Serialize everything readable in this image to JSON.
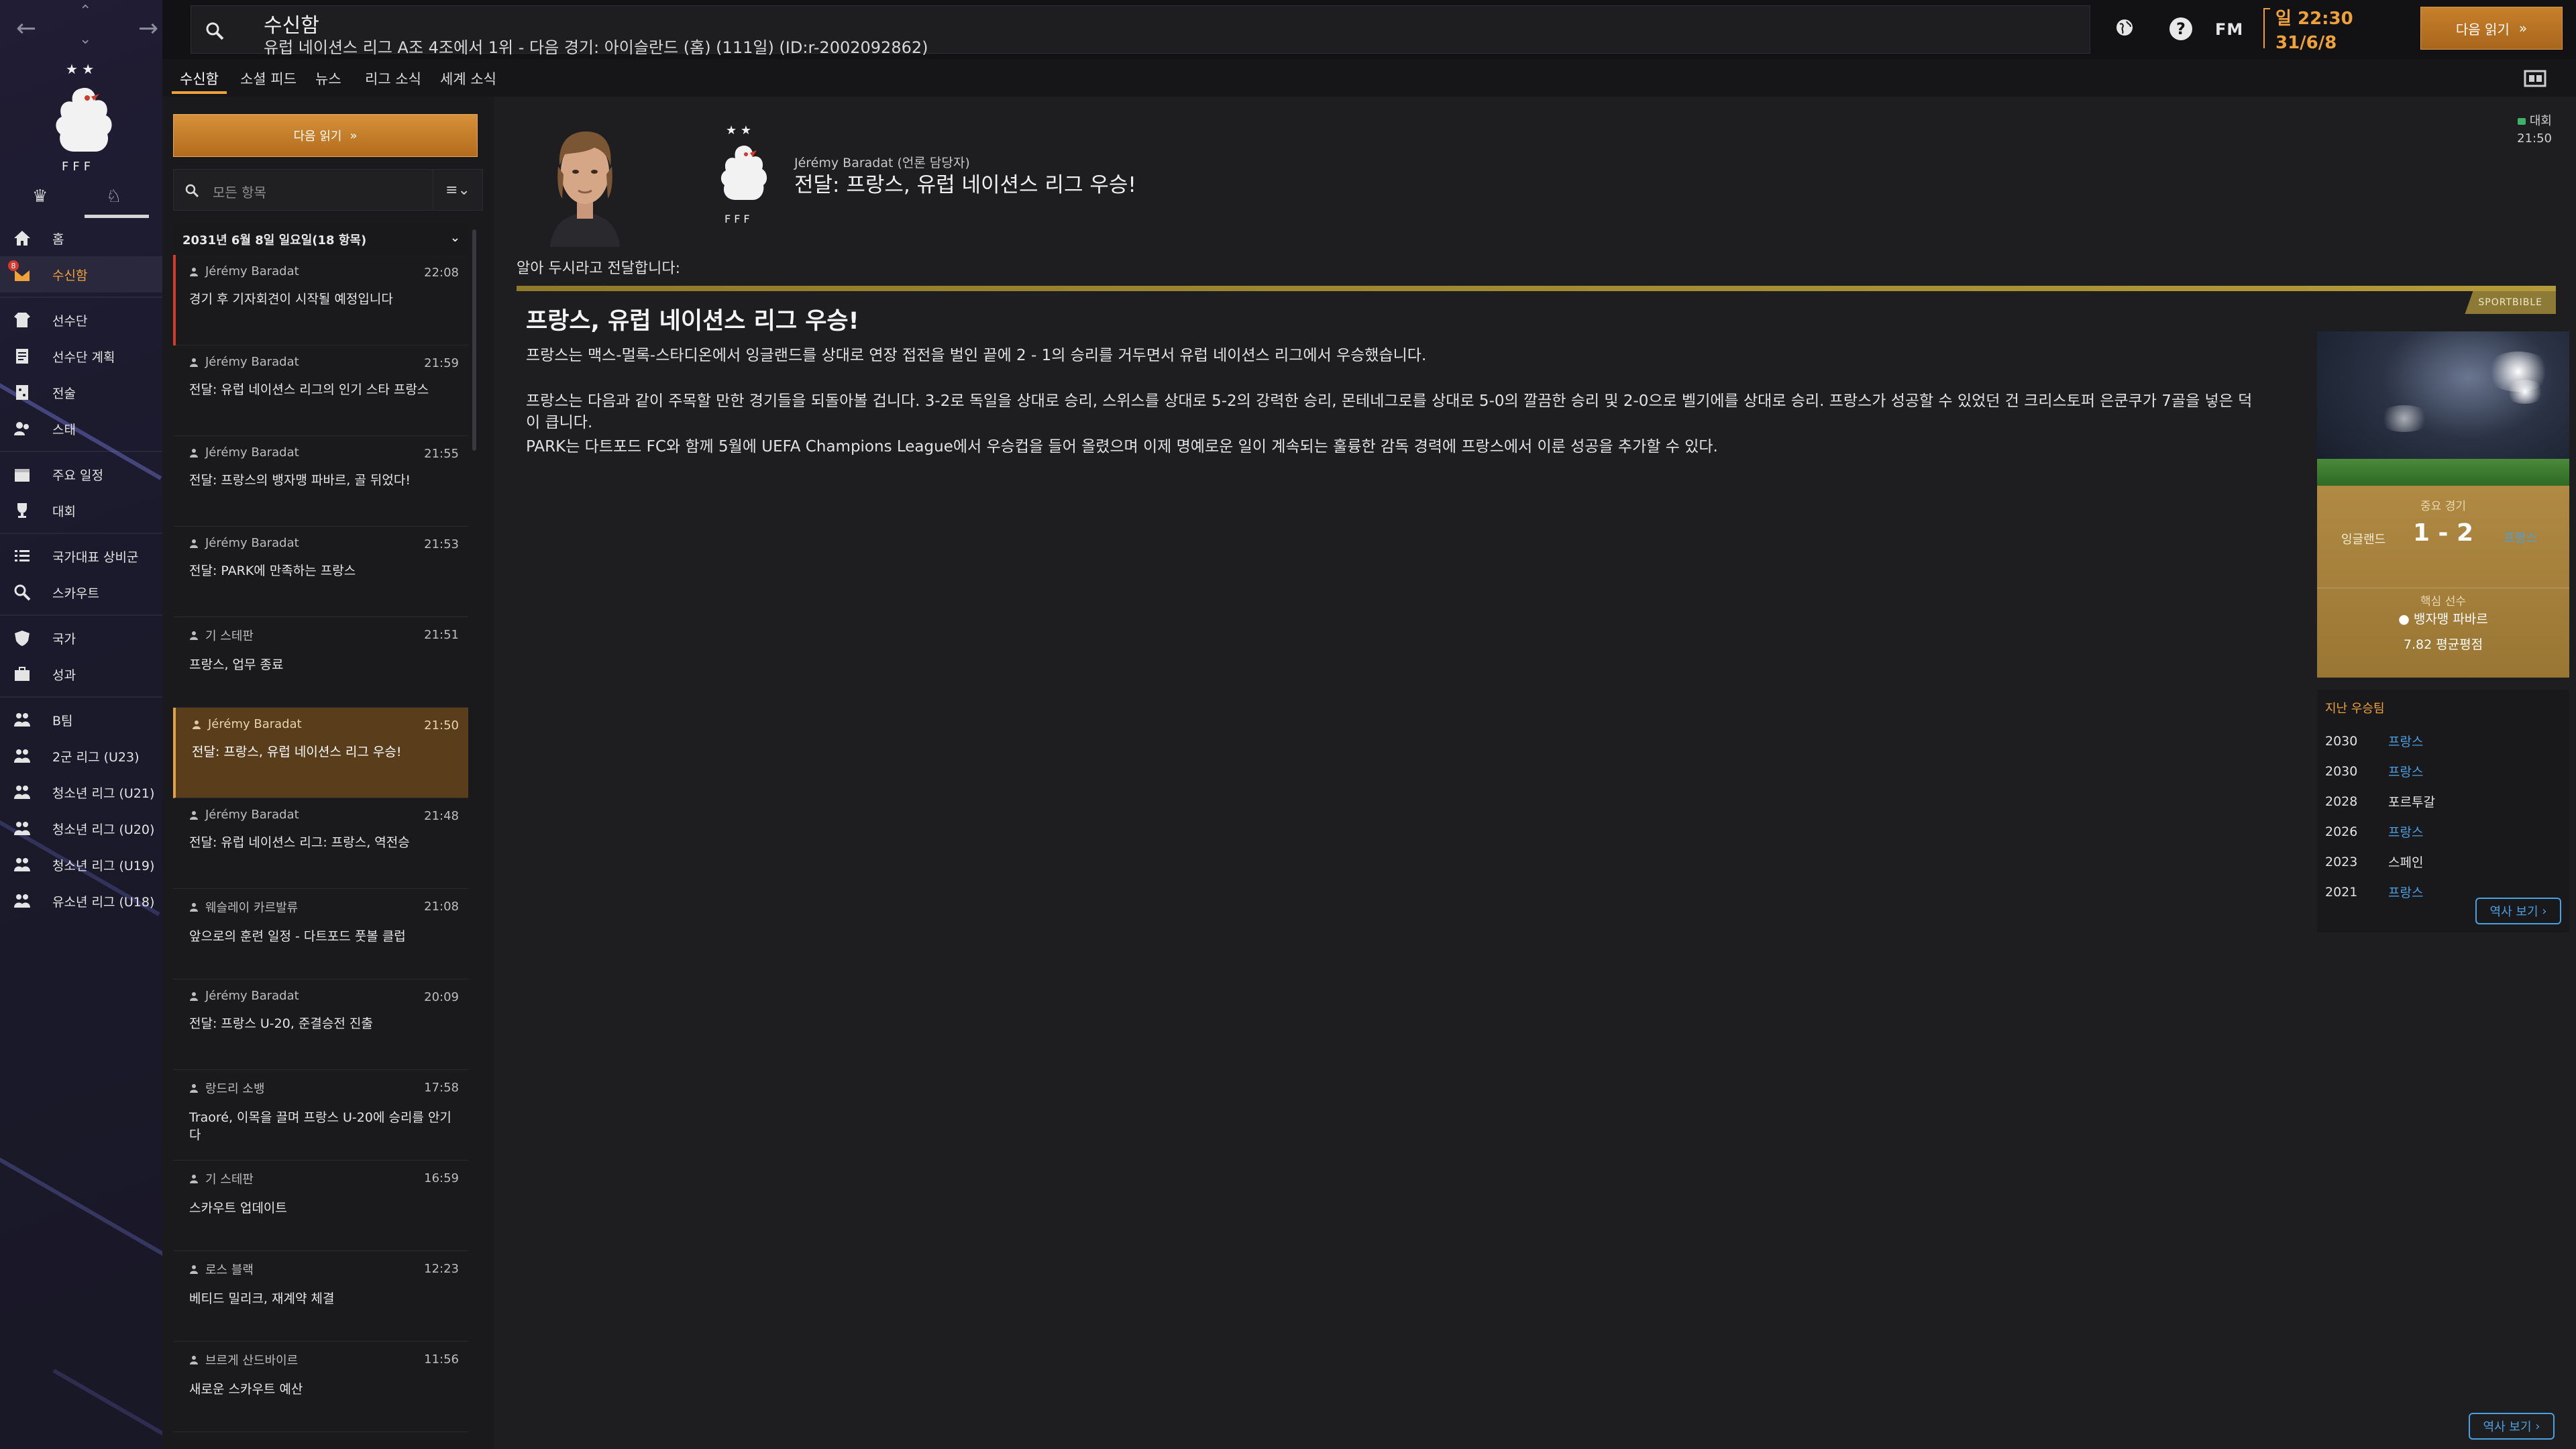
{
  "topbar": {
    "title": "수신함",
    "subtitle": "유럽 네이션스 리그 A조 4조에서 1위 - 다음 경기: 아이슬란드 (홈) (111일) (ID:r-2002092862)",
    "fm_label": "FM",
    "help_label": "?",
    "day_time": "일 22:30",
    "date": "31/6/8",
    "continue_label": "다음 읽기"
  },
  "sidebar": {
    "badge_count": "8",
    "items": [
      {
        "label": "홈",
        "icon": "home-icon"
      },
      {
        "label": "수신함",
        "icon": "inbox-icon",
        "active": true
      },
      {
        "label": "선수단",
        "icon": "squad-icon"
      },
      {
        "label": "선수단 계획",
        "icon": "squad-plan-icon"
      },
      {
        "label": "전술",
        "icon": "tactics-icon"
      },
      {
        "label": "스태",
        "icon": "staff-icon"
      },
      {
        "label": "주요 일정",
        "icon": "calendar-icon"
      },
      {
        "label": "대회",
        "icon": "trophy-icon"
      },
      {
        "label": "국가대표 상비군",
        "icon": "list-icon"
      },
      {
        "label": "스카우트",
        "icon": "scout-icon"
      },
      {
        "label": "국가",
        "icon": "nation-icon"
      },
      {
        "label": "성과",
        "icon": "performance-icon"
      },
      {
        "label": "B팀",
        "icon": "team-icon"
      },
      {
        "label": "2군 리그 (U23)",
        "icon": "team-icon"
      },
      {
        "label": "청소년 리그 (U21)",
        "icon": "team-icon"
      },
      {
        "label": "청소년 리그 (U20)",
        "icon": "team-icon"
      },
      {
        "label": "청소년 리그 (U19)",
        "icon": "team-icon"
      },
      {
        "label": "유소년 리그 (U18)",
        "icon": "team-icon"
      }
    ]
  },
  "tabs": [
    {
      "label": "수신함",
      "active": true
    },
    {
      "label": "소셜 피드"
    },
    {
      "label": "뉴스"
    },
    {
      "label": "리그 소식"
    },
    {
      "label": "세계 소식"
    }
  ],
  "inbox": {
    "continue_label": "다음 읽기",
    "filter_placeholder": "모든 항목",
    "date_header": "2031년 6월 8일 일요일(18 항목)",
    "items": [
      {
        "sender": "Jérémy Baradat",
        "time": "22:08",
        "subject": "경기 후 기자회견이 시작될 예정입니다",
        "unread": true
      },
      {
        "sender": "Jérémy Baradat",
        "time": "21:59",
        "subject": "전달: 유럽 네이션스 리그의 인기 스타 프랑스"
      },
      {
        "sender": "Jérémy Baradat",
        "time": "21:55",
        "subject": "전달: 프랑스의 뱅자맹 파바르, 골 뒤었다!"
      },
      {
        "sender": "Jérémy Baradat",
        "time": "21:53",
        "subject": "전달: PARK에 만족하는 프랑스"
      },
      {
        "sender": "기 스테판",
        "time": "21:51",
        "subject": "프랑스, 업무 종료"
      },
      {
        "sender": "Jérémy Baradat",
        "time": "21:50",
        "subject": "전달: 프랑스, 유럽 네이션스 리그 우승!",
        "selected": true
      },
      {
        "sender": "Jérémy Baradat",
        "time": "21:48",
        "subject": "전달: 유럽 네이션스 리그: 프랑스, 역전승"
      },
      {
        "sender": "웨슬레이 카르발류",
        "time": "21:08",
        "subject": "앞으로의 훈련 일정 - 다트포드 풋볼 클럽"
      },
      {
        "sender": "Jérémy Baradat",
        "time": "20:09",
        "subject": "전달: 프랑스 U-20, 준결승전 진출"
      },
      {
        "sender": "랑드리 소뱅",
        "time": "17:58",
        "subject": "Traoré, 이목을 끌며 프랑스 U-20에 승리를 안기다"
      },
      {
        "sender": "기 스테판",
        "time": "16:59",
        "subject": "스카우트 업데이트"
      },
      {
        "sender": "로스 블랙",
        "time": "12:23",
        "subject": "베티드 밀리크, 재계약 체결"
      },
      {
        "sender": "브르게 산드바이르",
        "time": "11:56",
        "subject": "새로운 스카우트 예산"
      }
    ]
  },
  "message": {
    "from": "Jérémy Baradat (언론 담당자)",
    "subject": "전달: 프랑스, 유럽 네이션스 리그 우승!",
    "competition_tag": "대회",
    "time": "21:50",
    "intro": "알아 두시라고 전달합니다:",
    "article": {
      "source_tag": "SPORTBIBLE",
      "headline": "프랑스, 유럽 네이션스 리그 우승!",
      "paragraphs": [
        "프랑스는 맥스-멀록-스타디온에서 잉글랜드를 상대로 연장 접전을 벌인 끝에 2 - 1의 승리를 거두면서 유럽 네이션스 리그에서 우승했습니다.",
        "프랑스는 다음과 같이 주목할 만한 경기들을 되돌아볼 겁니다. 3-2로 독일을 상대로 승리, 스위스를 상대로 5-2의 강력한 승리, 몬테네그로를 상대로 5-0의 깔끔한 승리 및 2-0으로 벨기에를 상대로 승리. 프랑스가 성공할 수 있었던 건 크리스토퍼 은쿤쿠가 7골을 넣은 덕이 큽니다.",
        "PARK는 다트포드 FC와 함께 5월에 UEFA Champions League에서 우승컵을 들어 올렸으며 이제 명예로운 일이 계속되는 훌륭한 감독 경력에 프랑스에서 이룬 성공을 추가할 수 있다."
      ]
    },
    "result": {
      "label": "중요 경기",
      "home": "잉글랜드",
      "score": "1 - 2",
      "away": "프랑스",
      "key_player_label": "핵심 선수",
      "key_player": "뱅자맹 파바르",
      "rating": "7.82 평균평점"
    },
    "past_winners": {
      "title": "지난 우승팀",
      "rows": [
        {
          "year": "2030",
          "team": "프랑스",
          "link": true
        },
        {
          "year": "2030",
          "team": "프랑스",
          "link": true
        },
        {
          "year": "2028",
          "team": "포르투갈",
          "link": false
        },
        {
          "year": "2026",
          "team": "프랑스",
          "link": true
        },
        {
          "year": "2023",
          "team": "스페인",
          "link": false
        },
        {
          "year": "2021",
          "team": "프랑스",
          "link": true
        }
      ],
      "history_label": "역사 보기"
    },
    "bottom_history_label": "역사 보기"
  },
  "colors": {
    "accent": "#f0a23a",
    "link": "#4aa0e0",
    "selected_bg": "#5a3e1c",
    "article_bar": "#b39a3a"
  }
}
